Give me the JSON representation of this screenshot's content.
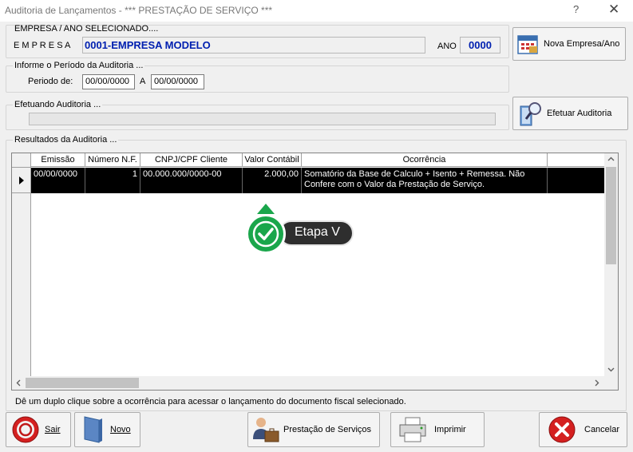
{
  "window": {
    "title": "Auditoria de Lançamentos - *** PRESTAÇÃO DE SERVIÇO ***",
    "help_label": "?",
    "close_label": "✕"
  },
  "empresa": {
    "group_label": "EMPRESA  /  ANO  SELECIONADO....",
    "empresa_label": "E M P R E S A",
    "empresa_value": "0001-EMPRESA MODELO",
    "ano_label": "ANO",
    "ano_value": "0000",
    "nova_button_label": "Nova Empresa/Ano"
  },
  "periodo": {
    "group_label": "Informe o Período da Auditoria ...",
    "periodo_label": "Periodo de:",
    "date_from": "00/00/0000",
    "a_label": "A",
    "date_to": "00/00/0000"
  },
  "efetuando": {
    "group_label": "Efetuando Auditoria ...",
    "progress": 0,
    "button_label": "Efetuar Auditoria"
  },
  "resultados": {
    "group_label": "Resultados da Auditoria ...",
    "columns": [
      "Emissão",
      "Número N.F.",
      "CNPJ/CPF Cliente",
      "Valor Contábil",
      "Ocorrência"
    ],
    "rows": [
      {
        "emissao": "00/00/0000",
        "numero": "1",
        "cnpj": "00.000.000/0000-00",
        "valor": "2.000,00",
        "ocorrencia": "Somatório da Base de Calculo + Isento + Remessa. Não Confere com o Valor da Prestação de Serviço."
      }
    ],
    "hint": "Dê um duplo clique sobre a ocorrência para acessar o lançamento do documento fiscal selecionado."
  },
  "callout": {
    "label": "Etapa V",
    "color": "#1aa64b"
  },
  "footer": {
    "sair_label": "Sair",
    "novo_label": "Novo",
    "prestacao_label": "Prestação de Serviços",
    "imprimir_label": "Imprimir",
    "cancelar_label": "Cancelar"
  }
}
